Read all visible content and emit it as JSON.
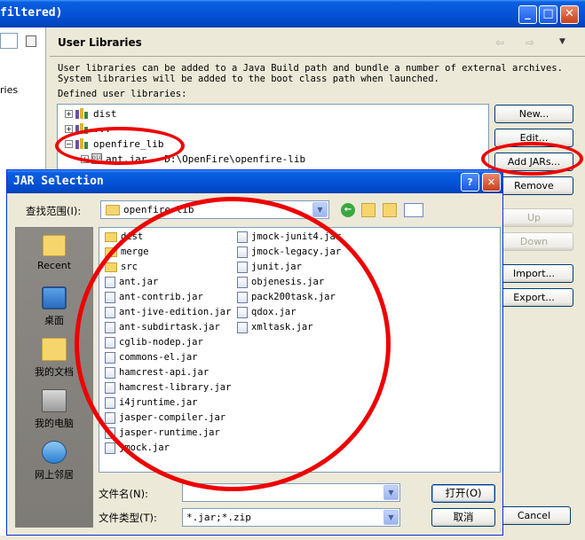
{
  "pref_window": {
    "title": "filtered)",
    "left_tree_item": "ries",
    "page_title": "User Libraries",
    "description": "User libraries can be added to a Java Build path and bundle a number of external archives. System libraries will be added to the boot class path when launched.",
    "defined_label": "Defined user libraries:",
    "libraries": [
      {
        "name": "dist",
        "expander": "+"
      },
      {
        "name": "...",
        "expander": "+"
      },
      {
        "name": "openfire_lib",
        "expander": "−"
      }
    ],
    "jar_entry": "ant.jar - D:\\OpenFire\\openfire-lib",
    "buttons": {
      "new": "New...",
      "edit": "Edit...",
      "add_jars": "Add JARs...",
      "remove": "Remove",
      "up": "Up",
      "down": "Down",
      "import": "Import...",
      "export": "Export...",
      "cancel": "Cancel"
    },
    "nav_back": "⇦",
    "nav_fwd": "⇨",
    "nav_menu": "▼"
  },
  "dialog": {
    "title": "JAR Selection",
    "help": "?",
    "close": "✕",
    "look_in_label": "查找范围(I):",
    "look_in_value": "openfire-lib",
    "places": [
      {
        "label": "Recent",
        "icon": "recent-folder-icon"
      },
      {
        "label": "桌面",
        "icon": "desktop-icon"
      },
      {
        "label": "我的文档",
        "icon": "my-documents-icon"
      },
      {
        "label": "我的电脑",
        "icon": "my-computer-icon"
      },
      {
        "label": "网上邻居",
        "icon": "network-places-icon"
      }
    ],
    "files_col1": [
      {
        "name": "dist",
        "kind": "dir"
      },
      {
        "name": "merge",
        "kind": "dir"
      },
      {
        "name": "src",
        "kind": "dir"
      },
      {
        "name": "ant.jar",
        "kind": "jar"
      },
      {
        "name": "ant-contrib.jar",
        "kind": "jar"
      },
      {
        "name": "ant-jive-edition.jar",
        "kind": "jar"
      },
      {
        "name": "ant-subdirtask.jar",
        "kind": "jar"
      },
      {
        "name": "cglib-nodep.jar",
        "kind": "jar"
      },
      {
        "name": "commons-el.jar",
        "kind": "jar"
      },
      {
        "name": "hamcrest-api.jar",
        "kind": "jar"
      },
      {
        "name": "hamcrest-library.jar",
        "kind": "jar"
      },
      {
        "name": "i4jruntime.jar",
        "kind": "jar"
      },
      {
        "name": "jasper-compiler.jar",
        "kind": "jar"
      },
      {
        "name": "jasper-runtime.jar",
        "kind": "jar"
      },
      {
        "name": "jmock.jar",
        "kind": "jar"
      }
    ],
    "files_col2": [
      {
        "name": "jmock-junit4.jar",
        "kind": "jar"
      },
      {
        "name": "jmock-legacy.jar",
        "kind": "jar"
      },
      {
        "name": "junit.jar",
        "kind": "jar"
      },
      {
        "name": "objenesis.jar",
        "kind": "jar"
      },
      {
        "name": "pack200task.jar",
        "kind": "jar"
      },
      {
        "name": "qdox.jar",
        "kind": "jar"
      },
      {
        "name": "xmltask.jar",
        "kind": "jar"
      }
    ],
    "filename_label": "文件名(N):",
    "filename_value": "",
    "filetype_label": "文件类型(T):",
    "filetype_value": "*.jar;*.zip",
    "open_button": "打开(O)",
    "cancel_button": "取消"
  },
  "colors": {
    "annotation_red": "#ee0000",
    "xp_title_blue": "#0655d8",
    "dialog_face": "#ece9d8"
  }
}
